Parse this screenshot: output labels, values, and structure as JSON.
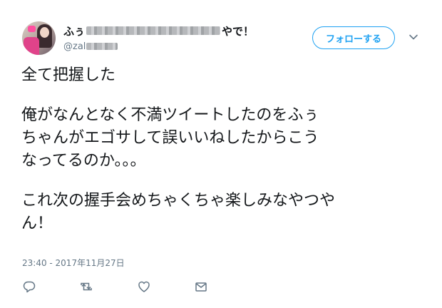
{
  "author": {
    "display_name_start": "ふぅ",
    "display_name_end": "やで！",
    "handle_prefix": "@zal",
    "avatar": "user-avatar-photo"
  },
  "follow_button": {
    "label": "フォローする"
  },
  "tweet": {
    "lines": [
      "全て把握した",
      "",
      "俺がなんとなく不満ツイートしたのをふぅ",
      "ちゃんがエゴサして誤いいねしたからこう",
      "なってるのか。。。",
      "",
      "これ次の握手会めちゃくちゃ楽しみなやつや",
      "ん！"
    ],
    "timestamp": "23:40 - 2017年11月27日"
  },
  "actions": [
    {
      "icon": "reply-icon"
    },
    {
      "icon": "retweet-icon"
    },
    {
      "icon": "like-heart-icon"
    },
    {
      "icon": "direct-message-icon"
    }
  ],
  "colors": {
    "accent": "#1da1f2",
    "secondary_text": "#657786",
    "primary_text": "#14171a"
  }
}
